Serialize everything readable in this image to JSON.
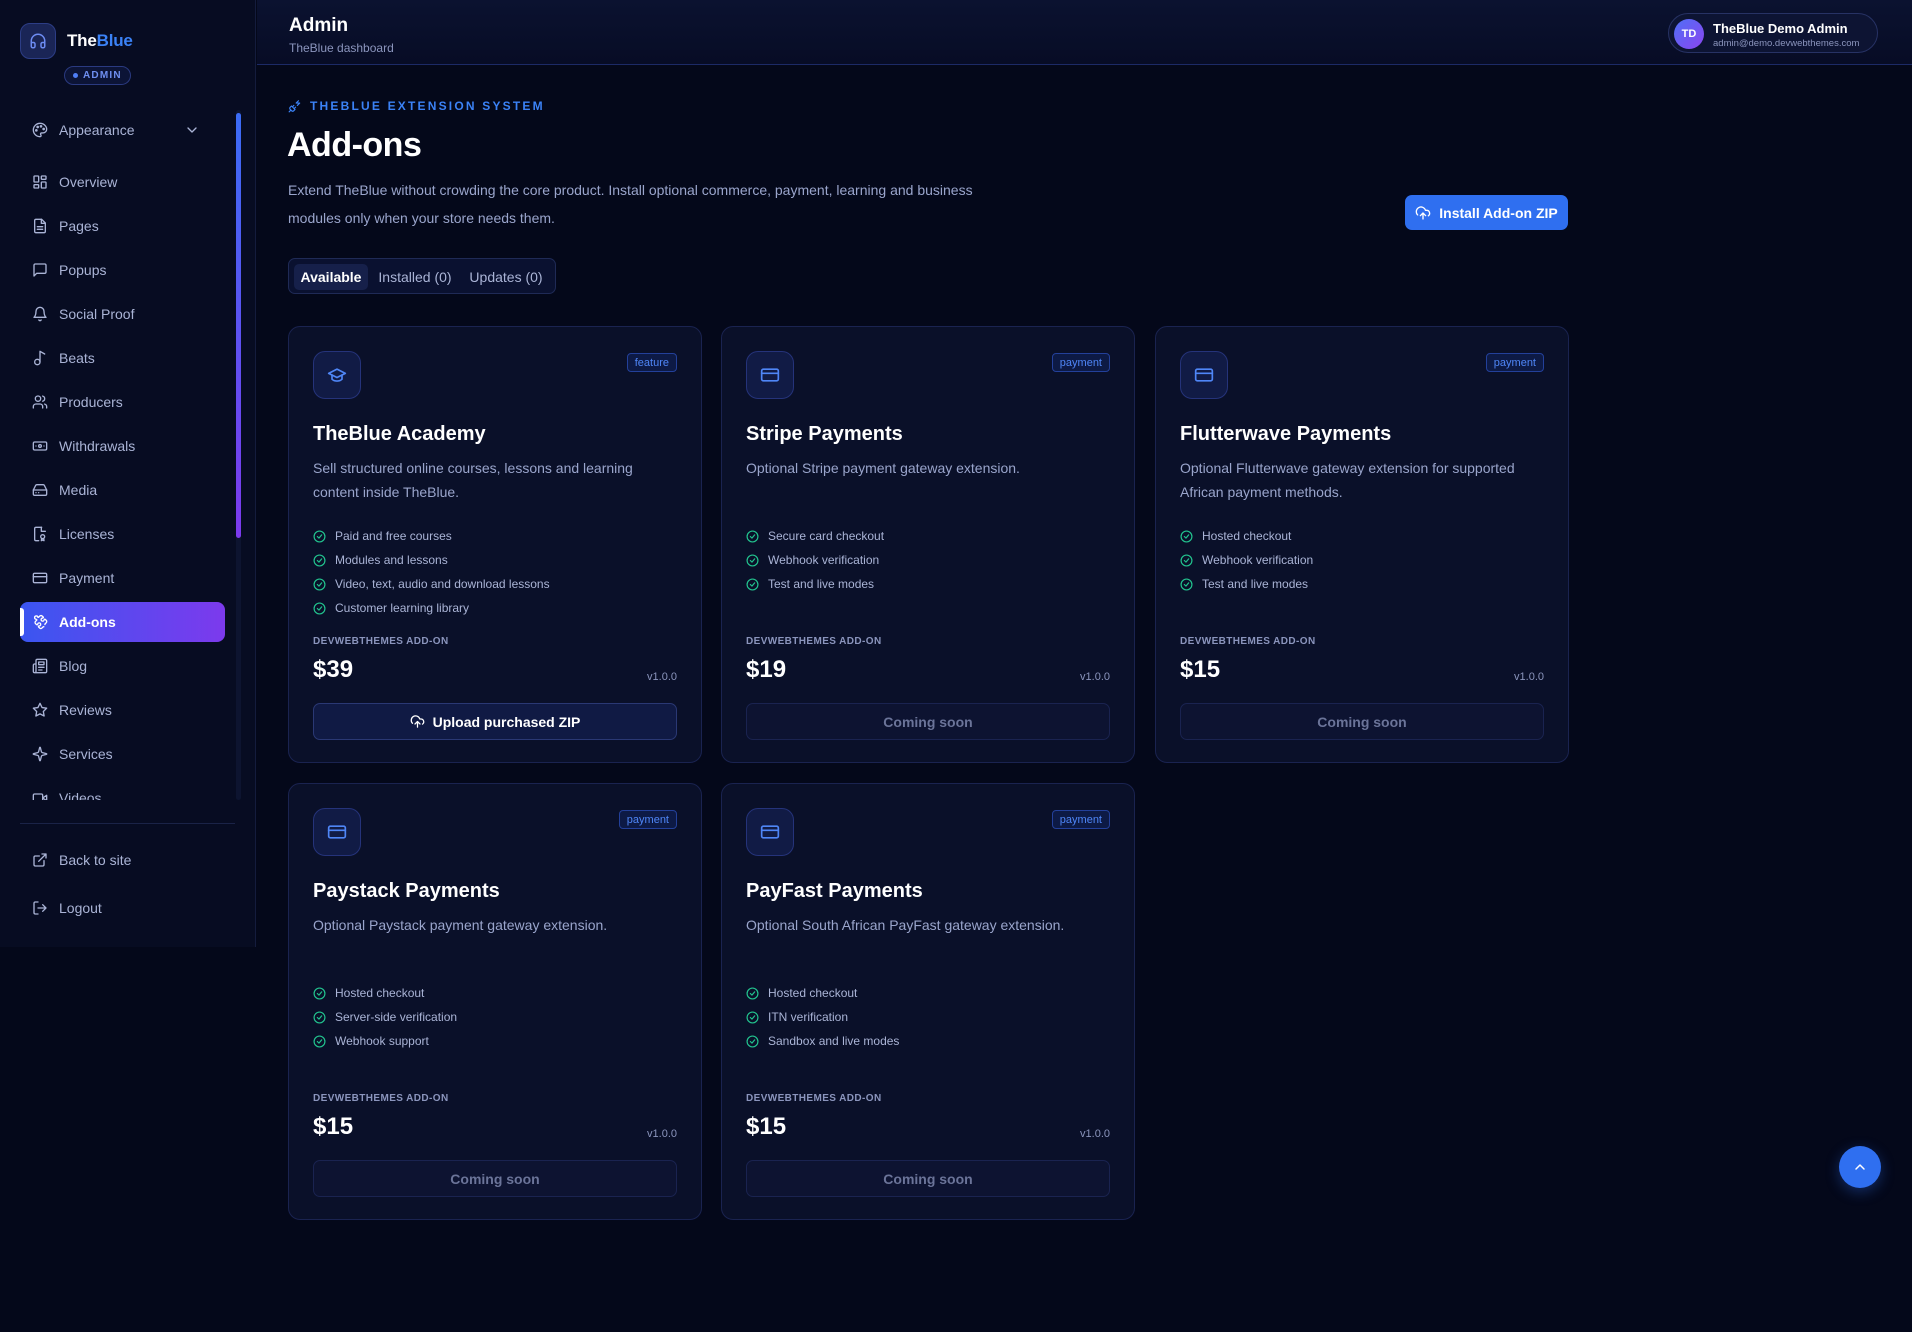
{
  "brand": {
    "name_part1": "The",
    "name_part2": "Blue",
    "badge": "ADMIN"
  },
  "header": {
    "title": "Admin",
    "subtitle": "TheBlue dashboard",
    "user": {
      "initials": "TD",
      "name": "TheBlue Demo Admin",
      "email": "admin@demo.devwebthemes.com"
    }
  },
  "sidebar": {
    "items": [
      {
        "label": "Appearance",
        "icon": "palette-icon"
      },
      {
        "label": "Overview",
        "icon": "grid-icon"
      },
      {
        "label": "Pages",
        "icon": "file-icon"
      },
      {
        "label": "Popups",
        "icon": "message-icon"
      },
      {
        "label": "Social Proof",
        "icon": "bell-icon"
      },
      {
        "label": "Beats",
        "icon": "music-icon"
      },
      {
        "label": "Producers",
        "icon": "users-icon"
      },
      {
        "label": "Withdrawals",
        "icon": "banknote-icon"
      },
      {
        "label": "Media",
        "icon": "drive-icon"
      },
      {
        "label": "Licenses",
        "icon": "license-icon"
      },
      {
        "label": "Payment",
        "icon": "card-icon"
      },
      {
        "label": "Add-ons",
        "icon": "puzzle-icon"
      },
      {
        "label": "Blog",
        "icon": "newspaper-icon"
      },
      {
        "label": "Reviews",
        "icon": "star-icon"
      },
      {
        "label": "Services",
        "icon": "sparkles-icon"
      },
      {
        "label": "Videos",
        "icon": "video-icon"
      }
    ],
    "footer": [
      {
        "label": "Back to site",
        "icon": "external-link-icon"
      },
      {
        "label": "Logout",
        "icon": "logout-icon"
      }
    ]
  },
  "page": {
    "eyebrow": "THEBLUE EXTENSION SYSTEM",
    "title": "Add-ons",
    "lead": "Extend TheBlue without crowding the core product. Install optional commerce, payment, learning and business modules only when your store needs them.",
    "install_button": "Install Add-on ZIP",
    "tabs": [
      "Available",
      "Installed (0)",
      "Updates (0)"
    ]
  },
  "addons": [
    {
      "tag": "feature",
      "icon": "graduation-cap-icon",
      "title": "TheBlue Academy",
      "description": "Sell structured online courses, lessons and learning content inside TheBlue.",
      "features": [
        "Paid and free courses",
        "Modules and lessons",
        "Video, text, audio and download lessons",
        "Customer learning library"
      ],
      "vendor": "DEVWEBTHEMES ADD-ON",
      "price": "$39",
      "version": "v1.0.0",
      "action": "Upload purchased ZIP"
    },
    {
      "tag": "payment",
      "icon": "credit-card-icon",
      "title": "Stripe Payments",
      "description": "Optional Stripe payment gateway extension.",
      "features": [
        "Secure card checkout",
        "Webhook verification",
        "Test and live modes"
      ],
      "vendor": "DEVWEBTHEMES ADD-ON",
      "price": "$19",
      "version": "v1.0.0",
      "action": "Coming soon"
    },
    {
      "tag": "payment",
      "icon": "credit-card-icon",
      "title": "Flutterwave Payments",
      "description": "Optional Flutterwave gateway extension for supported African payment methods.",
      "features": [
        "Hosted checkout",
        "Webhook verification",
        "Test and live modes"
      ],
      "vendor": "DEVWEBTHEMES ADD-ON",
      "price": "$15",
      "version": "v1.0.0",
      "action": "Coming soon"
    },
    {
      "tag": "payment",
      "icon": "credit-card-icon",
      "title": "Paystack Payments",
      "description": "Optional Paystack payment gateway extension.",
      "features": [
        "Hosted checkout",
        "Server-side verification",
        "Webhook support"
      ],
      "vendor": "DEVWEBTHEMES ADD-ON",
      "price": "$15",
      "version": "v1.0.0",
      "action": "Coming soon"
    },
    {
      "tag": "payment",
      "icon": "credit-card-icon",
      "title": "PayFast Payments",
      "description": "Optional South African PayFast gateway extension.",
      "features": [
        "Hosted checkout",
        "ITN verification",
        "Sandbox and live modes"
      ],
      "vendor": "DEVWEBTHEMES ADD-ON",
      "price": "$15",
      "version": "v1.0.0",
      "action": "Coming soon"
    }
  ],
  "colors": {
    "accent": "#2f6ff0",
    "active_gradient_start": "#3a56f0",
    "active_gradient_end": "#7c3aed",
    "check": "#22c38e",
    "background": "#04081a"
  }
}
